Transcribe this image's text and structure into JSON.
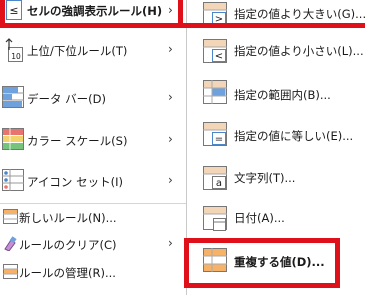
{
  "colors": {
    "highlight": "#e0101a",
    "grid_blue": "#4a86c8",
    "grid_orange": "#f7b26a",
    "grid_fill": "#f3d6b8",
    "bar_blue": "#6fa1dc",
    "scale_red": "#e8746f",
    "scale_yellow": "#f2d36b",
    "scale_green": "#76c47b"
  },
  "left_menu": {
    "items": [
      {
        "label": "セルの強調表示ルール(H)",
        "icon": "highlight-cells-rules-icon",
        "has_submenu": true
      },
      {
        "label": "上位/下位ルール(T)",
        "icon": "top-bottom-rules-icon",
        "has_submenu": true
      },
      {
        "label": "データ バー(D)",
        "icon": "data-bars-icon",
        "has_submenu": true
      },
      {
        "label": "カラー スケール(S)",
        "icon": "color-scales-icon",
        "has_submenu": true
      },
      {
        "label": "アイコン セット(I)",
        "icon": "icon-sets-icon",
        "has_submenu": true
      }
    ],
    "bottom_items": [
      {
        "label": "新しいルール(N)...",
        "icon": "new-rule-icon"
      },
      {
        "label": "ルールのクリア(C)",
        "icon": "clear-rules-icon",
        "has_submenu": true
      },
      {
        "label": "ルールの管理(R)...",
        "icon": "manage-rules-icon"
      }
    ],
    "top_icon_glyph": "≤",
    "top_bottom_glyph": "10"
  },
  "right_menu": {
    "items": [
      {
        "label": "指定の値より大きい(G)...",
        "icon": "greater-than-icon",
        "glyph": ">"
      },
      {
        "label": "指定の値より小さい(L)...",
        "icon": "less-than-icon",
        "glyph": "<"
      },
      {
        "label": "指定の範囲内(B)...",
        "icon": "between-icon",
        "glyph": ""
      },
      {
        "label": "指定の値に等しい(E)...",
        "icon": "equal-to-icon",
        "glyph": "="
      },
      {
        "label": "文字列(T)...",
        "icon": "text-contains-icon",
        "glyph": "a"
      },
      {
        "label": "日付(A)...",
        "icon": "date-occurring-icon",
        "glyph": ""
      },
      {
        "label": "重複する値(D)...",
        "icon": "duplicate-values-icon",
        "glyph": ""
      }
    ]
  }
}
